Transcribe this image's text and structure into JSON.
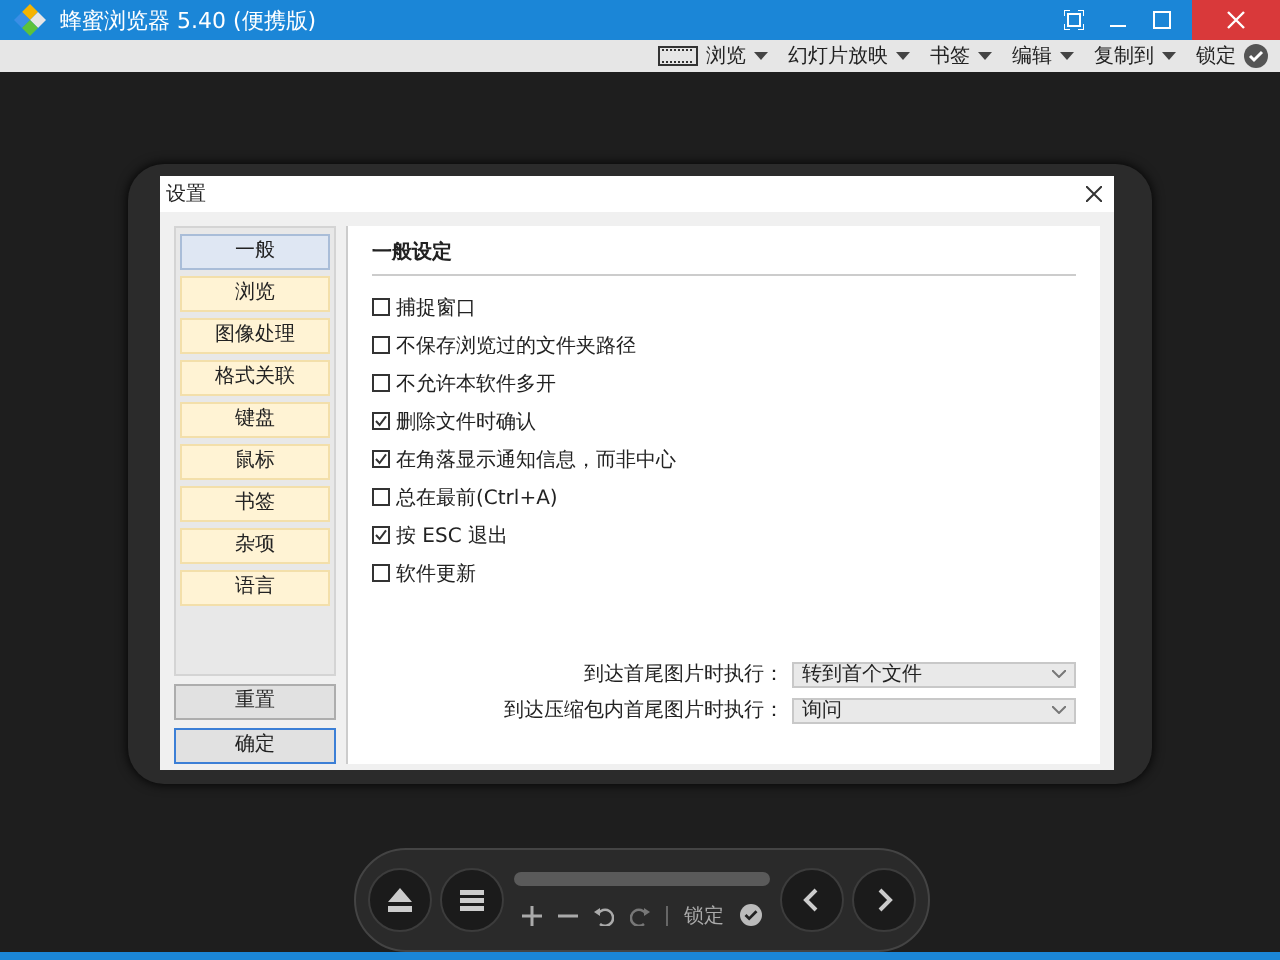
{
  "window": {
    "title": "蜂蜜浏览器 5.40 (便携版)"
  },
  "toolbar": [
    {
      "label": "浏览",
      "kind": "view"
    },
    {
      "label": "幻灯片放映",
      "kind": "menu"
    },
    {
      "label": "书签",
      "kind": "menu"
    },
    {
      "label": "编辑",
      "kind": "menu"
    },
    {
      "label": "复制到",
      "kind": "menu"
    },
    {
      "label": "锁定",
      "kind": "lock"
    }
  ],
  "dialog": {
    "title": "设置",
    "categories": [
      {
        "label": "一般",
        "selected": true
      },
      {
        "label": "浏览",
        "selected": false
      },
      {
        "label": "图像处理",
        "selected": false
      },
      {
        "label": "格式关联",
        "selected": false
      },
      {
        "label": "键盘",
        "selected": false
      },
      {
        "label": "鼠标",
        "selected": false
      },
      {
        "label": "书签",
        "selected": false
      },
      {
        "label": "杂项",
        "selected": false
      },
      {
        "label": "语言",
        "selected": false
      }
    ],
    "buttons": [
      {
        "label": "重置",
        "kind": "reset"
      },
      {
        "label": "确定",
        "kind": "ok"
      }
    ],
    "section_title": "一般设定",
    "options": [
      {
        "label": "捕捉窗口",
        "checked": false
      },
      {
        "label": "不保存浏览过的文件夹路径",
        "checked": false
      },
      {
        "label": "不允许本软件多开",
        "checked": false
      },
      {
        "label": "删除文件时确认",
        "checked": true
      },
      {
        "label": "在角落显示通知信息，而非中心",
        "checked": true
      },
      {
        "label": "总在最前(Ctrl+A)",
        "checked": false
      },
      {
        "label": "按 ESC 退出",
        "checked": true
      },
      {
        "label": "软件更新",
        "checked": false
      }
    ],
    "dropdowns": [
      {
        "label": "到达首尾图片时执行：",
        "value": "转到首个文件"
      },
      {
        "label": "到达压缩包内首尾图片时执行：",
        "value": "询问"
      }
    ]
  },
  "control_bar": {
    "lock_label": "锁定"
  }
}
